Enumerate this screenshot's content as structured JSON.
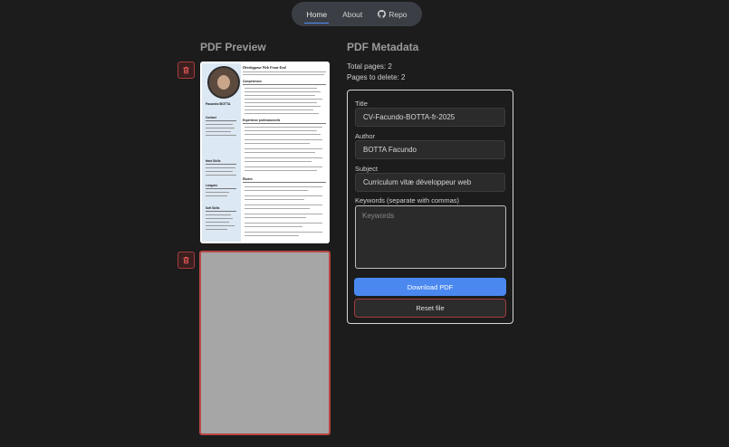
{
  "nav": {
    "items": [
      {
        "label": "Home",
        "active": true
      },
      {
        "label": "About",
        "active": false
      },
      {
        "label": "Repo",
        "active": false,
        "icon": "github-icon"
      }
    ]
  },
  "preview": {
    "title": "PDF Preview",
    "pages": [
      {
        "kind": "cv-thumbnail",
        "name": "Facundo BOTTA",
        "job_title": "Développeur Web Front-End"
      },
      {
        "kind": "blank-selected"
      }
    ],
    "delete_icon": "trash-icon"
  },
  "metadata": {
    "title": "PDF Metadata",
    "total_pages": "Total pages: 2",
    "pages_to_delete": "Pages to delete: 2",
    "fields": {
      "title_label": "Title",
      "title_value": "CV-Facundo-BOTTA-fr-2025",
      "author_label": "Author",
      "author_value": "BOTTA Facundo",
      "subject_label": "Subject",
      "subject_value": "Curriculum vitæ développeur web",
      "keywords_label": "Keywords (separate with commas)",
      "keywords_placeholder": "Keywords"
    },
    "download_label": "Download PDF",
    "reset_label": "Reset file"
  },
  "colors": {
    "background": "#1c1c1c",
    "accent": "#4a88f0",
    "danger": "#a33b3b"
  }
}
